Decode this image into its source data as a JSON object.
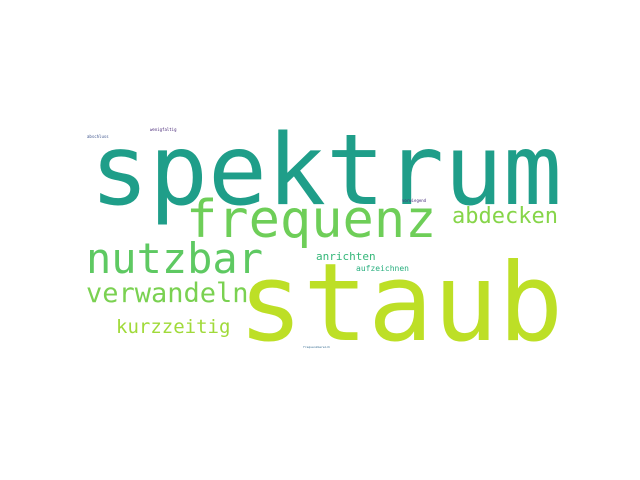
{
  "wordcloud": {
    "background": "#ffffff",
    "words": [
      {
        "key": "spektrum",
        "text": "spektrum",
        "color": "#1f9e89"
      },
      {
        "key": "staub",
        "text": "staub",
        "color": "#bddf26"
      },
      {
        "key": "frequenz",
        "text": "frequenz",
        "color": "#6ece58"
      },
      {
        "key": "nutzbar",
        "text": "nutzbar",
        "color": "#5ec962"
      },
      {
        "key": "verwandeln",
        "text": "verwandeln",
        "color": "#7ad151"
      },
      {
        "key": "abdecken",
        "text": "abdecken",
        "color": "#86d549"
      },
      {
        "key": "kurzzeitig",
        "text": "kurzzeitig",
        "color": "#a0da39"
      },
      {
        "key": "anrichten",
        "text": "anrichten",
        "color": "#35b779"
      },
      {
        "key": "aufzeichnen",
        "text": "aufzeichnen",
        "color": "#29af7f"
      },
      {
        "key": "abschluss",
        "text": "abschluss",
        "color": "#3b528b"
      },
      {
        "key": "wenigfaltig",
        "text": "wenigfaltig",
        "color": "#482878"
      },
      {
        "key": "vorwiegend",
        "text": "vorwiegend",
        "color": "#472d7b"
      },
      {
        "key": "frequenzbereich",
        "text": "frequenzbereich",
        "color": "#31688e"
      }
    ]
  }
}
